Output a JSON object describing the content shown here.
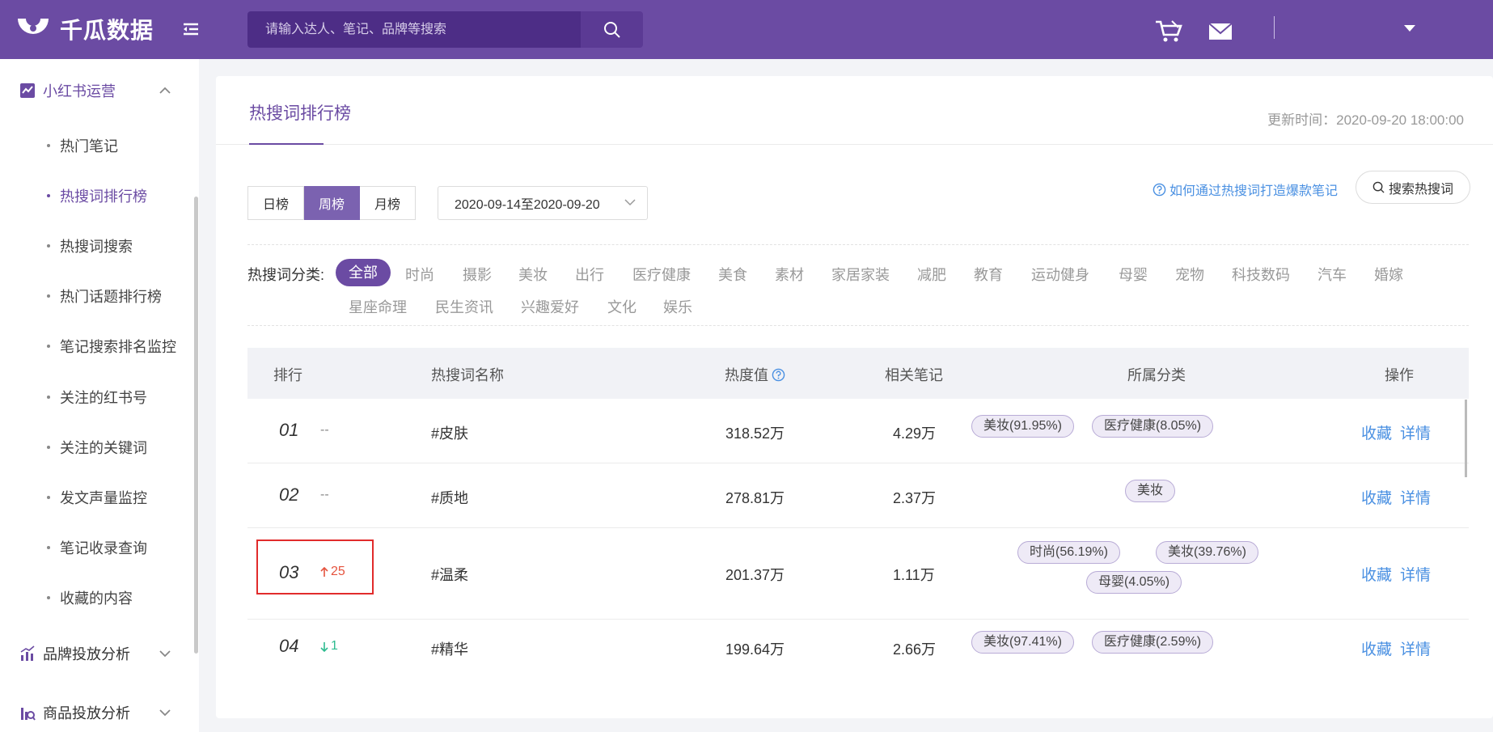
{
  "app": {
    "name": "千瓜数据"
  },
  "search": {
    "placeholder": "请输入达人、笔记、品牌等搜索"
  },
  "sidebar": {
    "groups": [
      {
        "label": "小红书运营",
        "icon": "xiaohongshu-icon",
        "expanded": true
      },
      {
        "label": "品牌投放分析",
        "icon": "chart-icon",
        "expanded": false
      },
      {
        "label": "商品投放分析",
        "icon": "product-chart-icon",
        "expanded": false
      }
    ],
    "items": [
      {
        "label": "热门笔记"
      },
      {
        "label": "热搜词排行榜",
        "active": true
      },
      {
        "label": "热搜词搜索"
      },
      {
        "label": "热门话题排行榜"
      },
      {
        "label": "笔记搜索排名监控"
      },
      {
        "label": "关注的红书号"
      },
      {
        "label": "关注的关键词"
      },
      {
        "label": "发文声量监控"
      },
      {
        "label": "笔记收录查询"
      },
      {
        "label": "收藏的内容"
      }
    ]
  },
  "page": {
    "title": "热搜词排行榜",
    "update_time": "更新时间：2020-09-20 18:00:00",
    "period_tabs": [
      "日榜",
      "周榜",
      "月榜"
    ],
    "period_selected": "周榜",
    "date_range": "2020-09-14至2020-09-20",
    "help_link": "如何通过热搜词打造爆款笔记",
    "search_hot_label": "搜索热搜词"
  },
  "categories": {
    "label": "热搜词分类:",
    "selected": "全部",
    "items": [
      "全部",
      "时尚",
      "摄影",
      "美妆",
      "出行",
      "医疗健康",
      "美食",
      "素材",
      "家居家装",
      "减肥",
      "教育",
      "运动健身",
      "母婴",
      "宠物",
      "科技数码",
      "汽车",
      "婚嫁",
      "星座命理",
      "民生资讯",
      "兴趣爱好",
      "文化",
      "娱乐"
    ]
  },
  "table": {
    "headers": [
      "排行",
      "热搜词名称",
      "热度值",
      "相关笔记",
      "所属分类",
      "操作"
    ],
    "rows": [
      {
        "rank": "01",
        "change": "--",
        "direction": "none",
        "keyword": "#皮肤",
        "heat": "318.52万",
        "notes": "4.29万",
        "tags": [
          "美妆(91.95%)",
          "医疗健康(8.05%)"
        ],
        "ops": [
          "收藏",
          "详情"
        ]
      },
      {
        "rank": "02",
        "change": "--",
        "direction": "none",
        "keyword": "#质地",
        "heat": "278.81万",
        "notes": "2.37万",
        "tags": [
          "美妆"
        ],
        "ops": [
          "收藏",
          "详情"
        ]
      },
      {
        "rank": "03",
        "change": "25",
        "direction": "up",
        "keyword": "#温柔",
        "heat": "201.37万",
        "notes": "1.11万",
        "tags": [
          "时尚(56.19%)",
          "美妆(39.76%)",
          "母婴(4.05%)"
        ],
        "ops": [
          "收藏",
          "详情"
        ]
      },
      {
        "rank": "04",
        "change": "1",
        "direction": "down",
        "keyword": "#精华",
        "heat": "199.64万",
        "notes": "2.66万",
        "tags": [
          "美妆(97.41%)",
          "医疗健康(2.59%)"
        ],
        "ops": [
          "收藏",
          "详情"
        ]
      }
    ]
  },
  "colors": {
    "brand": "#6b4ba3",
    "link": "#4a90e2",
    "up": "#e5533e",
    "down": "#2dbb8f",
    "highlight": "#e12b2b"
  }
}
